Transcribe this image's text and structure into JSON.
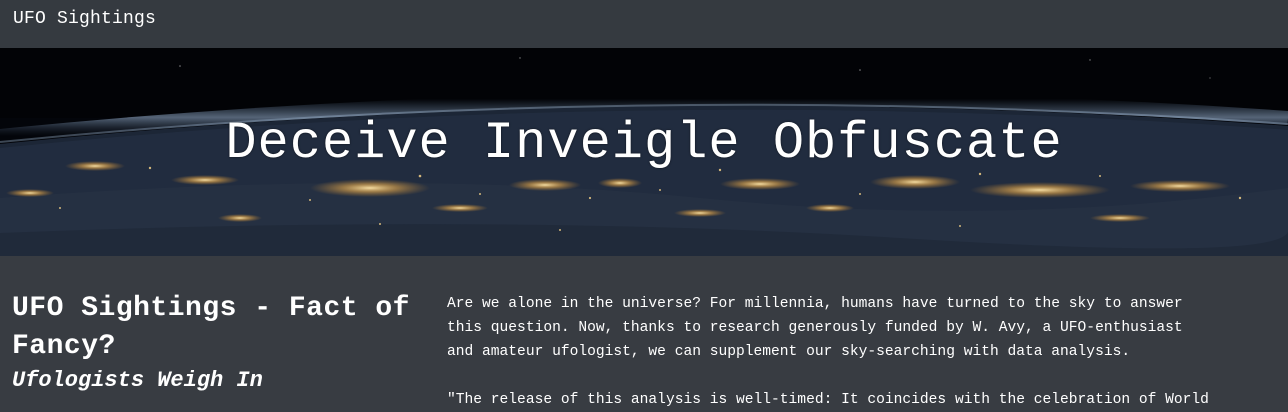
{
  "navbar": {
    "brand": "UFO Sightings"
  },
  "hero": {
    "title": "Deceive Inveigle Obfuscate"
  },
  "article": {
    "title": "UFO Sightings - Fact of Fancy?",
    "subtitle": "Ufologists Weigh In",
    "paragraphs": [
      "Are we alone in the universe? For millennia, humans have turned to the sky to answer this question. Now, thanks to research generously funded by W. Avy, a UFO-enthusiast and amateur ufologist, we can supplement our sky-searching with data analysis.",
      "\"The release of this analysis is well-timed: It coincides with the celebration of World"
    ]
  }
}
